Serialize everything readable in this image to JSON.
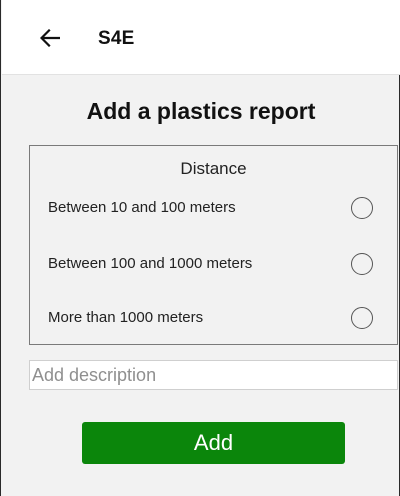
{
  "appbar": {
    "back_icon": "arrow-left-icon",
    "title": "S4E"
  },
  "page": {
    "title": "Add a plastics report"
  },
  "distance": {
    "label": "Distance",
    "options": [
      {
        "label": "Between 10 and 100 meters",
        "selected": false
      },
      {
        "label": "Between 100 and 1000 meters",
        "selected": false
      },
      {
        "label": "More than 1000 meters",
        "selected": false
      }
    ]
  },
  "description": {
    "value": "",
    "placeholder": "Add description"
  },
  "actions": {
    "add_label": "Add"
  },
  "colors": {
    "accent_green": "#0b860b",
    "background": "#f2f2f2",
    "appbar": "#ffffff"
  }
}
